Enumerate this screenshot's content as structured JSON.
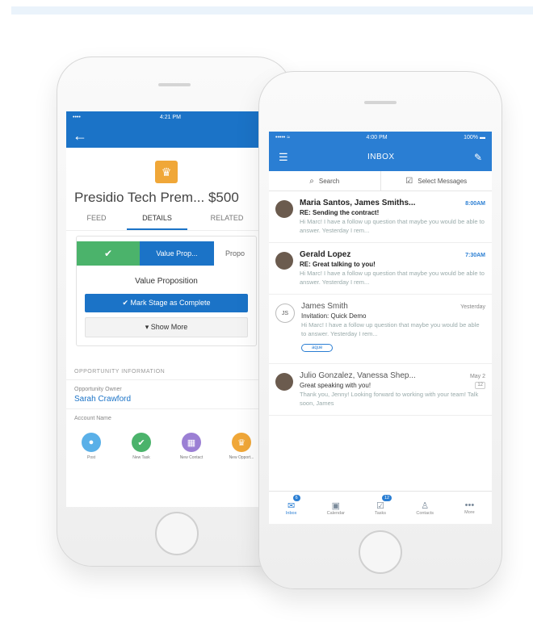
{
  "left_phone": {
    "status": {
      "carrier": "••••",
      "time": "4:21 PM"
    },
    "back_icon": "←",
    "record_icon": "crown-icon",
    "opportunity_title": "Presidio Tech Prem... $500",
    "tabs": [
      "FEED",
      "DETAILS",
      "RELATED"
    ],
    "active_tab": "DETAILS",
    "path_steps": [
      "✔",
      "Value Prop...",
      "Propo"
    ],
    "stage_title": "Value Proposition",
    "mark_complete": "✔  Mark Stage as Complete",
    "show_more": "▾  Show More",
    "section_title": "OPPORTUNITY INFORMATION",
    "owner_label": "Opportunity Owner",
    "owner_value": "Sarah Crawford",
    "account_label": "Account Name",
    "actions": [
      {
        "label": "Post",
        "color": "#5ab0e8",
        "icon": "●"
      },
      {
        "label": "New Task",
        "color": "#4bb36b",
        "icon": "✔"
      },
      {
        "label": "New Contact",
        "color": "#9b7fd4",
        "icon": "▦"
      },
      {
        "label": "New Opport...",
        "color": "#f0a738",
        "icon": "♛"
      }
    ]
  },
  "right_phone": {
    "status": {
      "carrier": "••••• ≈",
      "time": "4:00 PM",
      "battery": "100% ▬"
    },
    "header_title": "INBOX",
    "search_label": "Search",
    "select_label": "Select Messages",
    "messages": [
      {
        "sender": "Maria Santos, James Smiths...",
        "time": "8:00AM",
        "subject": "RE: Sending the contract!",
        "preview": "Hi Marc! I have a follow up question that maybe you would be able to answer. Yesterday I rem...",
        "unread": true,
        "avatar": ""
      },
      {
        "sender": "Gerald Lopez",
        "time": "7:30AM",
        "subject": "RE: Great talking to you!",
        "preview": "Hi Marc! I have a follow up question that maybe you would be able to answer. Yesterday I rem...",
        "unread": true,
        "avatar": ""
      },
      {
        "sender": "James Smith",
        "time": "Yesterday",
        "subject": "Invitation: Quick Demo",
        "preview": "Hi Marc! I have a follow up question that maybe you would be able to answer. Yesterday I rem...",
        "unread": false,
        "avatar": "JS",
        "tag": "aque"
      },
      {
        "sender": "Julio Gonzalez, Vanessa Shep...",
        "time": "May 2",
        "subject": "Great speaking with you!",
        "preview": "Thank you, Jenny! Looking forward to working with your team! Talk soon, James",
        "unread": false,
        "avatar": "",
        "count": "12"
      }
    ],
    "tabbar": [
      {
        "label": "Inbox",
        "icon": "✉",
        "badge": "6"
      },
      {
        "label": "Calendar",
        "icon": "▣",
        "badge": ""
      },
      {
        "label": "Tasks",
        "icon": "☑",
        "badge": "12"
      },
      {
        "label": "Contacts",
        "icon": "♙",
        "badge": ""
      },
      {
        "label": "More",
        "icon": "•••",
        "badge": ""
      }
    ]
  }
}
